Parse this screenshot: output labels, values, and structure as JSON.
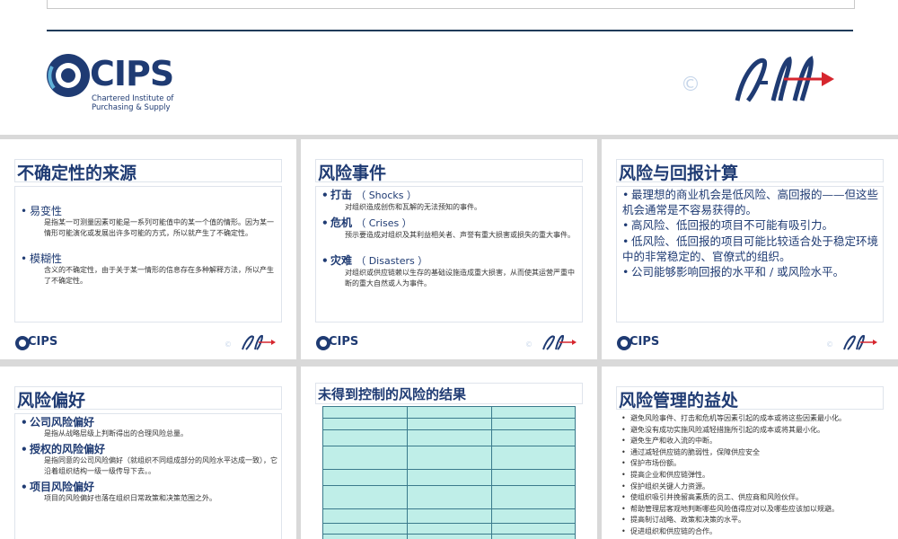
{
  "banner": {
    "logo_name": "CIPS",
    "logo_sub_line1": "Chartered Institute of",
    "logo_sub_line2": "Purchasing & Supply",
    "copyright": "©",
    "brand_color": "#1f3b73",
    "accent_red": "#d6262e"
  },
  "slides": [
    {
      "title": "不确定性的来源",
      "items": [
        {
          "label": "易变性",
          "desc": "是指某一可测量因素可能是一系列可能值中的某一个值的情形。因为某一情形可能演化或发展出许多可能的方式，所以就产生了不确定性。"
        },
        {
          "label": "模糊性",
          "desc": "含义的不确定性，由于关于某一情形的信息存在多种解释方法，所以产生了不确定性。"
        }
      ]
    },
    {
      "title": "风险事件",
      "items": [
        {
          "label": "打击",
          "en": "（ Shocks ）",
          "desc": "对组织造成创伤和瓦解的无法预知的事件。"
        },
        {
          "label": "危机",
          "en": "（ Crises ）",
          "desc": "预示要造成对组织及其利益相关者、声誉有重大损害或损失的重大事件。"
        },
        {
          "label": "灾难",
          "en": "（ Disasters ）",
          "desc": "对组织或供应链赖以生存的基础设施造成重大损害，从而使其运营严重中断的重大自然或人为事件。"
        }
      ]
    },
    {
      "title": "风险与回报计算",
      "points": [
        "最理想的商业机会是低风险、高回报的——但这些机会通常是不容易获得的。",
        "高风险、低回报的项目不可能有吸引力。",
        "低风险、低回报的项目可能比较适合处于稳定环境中的非常稳定的、官僚式的组织。",
        "公司能够影响回报的水平和 / 或风险水平。"
      ]
    },
    {
      "title": "风险偏好",
      "items": [
        {
          "label": "公司风险偏好",
          "desc": "是指从战略层级上判断得出的合理风险总量。"
        },
        {
          "label": "授权的风险偏好",
          "desc": "是指同意的公司风险偏好（就组织不同组成部分的风险水平达成一致），它沿着组织结构一级一级传导下去。。"
        },
        {
          "label": "项目风险偏好",
          "desc": "项目的风险偏好也落在组织日常政策和决策范围之外。"
        }
      ]
    },
    {
      "title": "未得到控制的风险的结果"
    },
    {
      "title": "风险管理的益处",
      "points": [
        "避免风险事件、打击和危机等因素引起的成本或将这些因素最小化。",
        "避免没有成功实施风险减轻措施所引起的成本或将其最小化。",
        "避免生产和收入流的中断。",
        "通过减轻供应链的脆弱性，保障供应安全",
        "保护市场份额。",
        "提高企业和供应链弹性。",
        "保护组织关键人力资源。",
        "使组织吸引并挽留高素质的员工、供应商和风险伙伴。",
        "帮助管理层客观地判断哪些风险值得应对以及哪些应该加以规避。",
        "提高制订战略、政策和决策的水平。",
        "促进组织和供应链的合作。"
      ]
    }
  ]
}
